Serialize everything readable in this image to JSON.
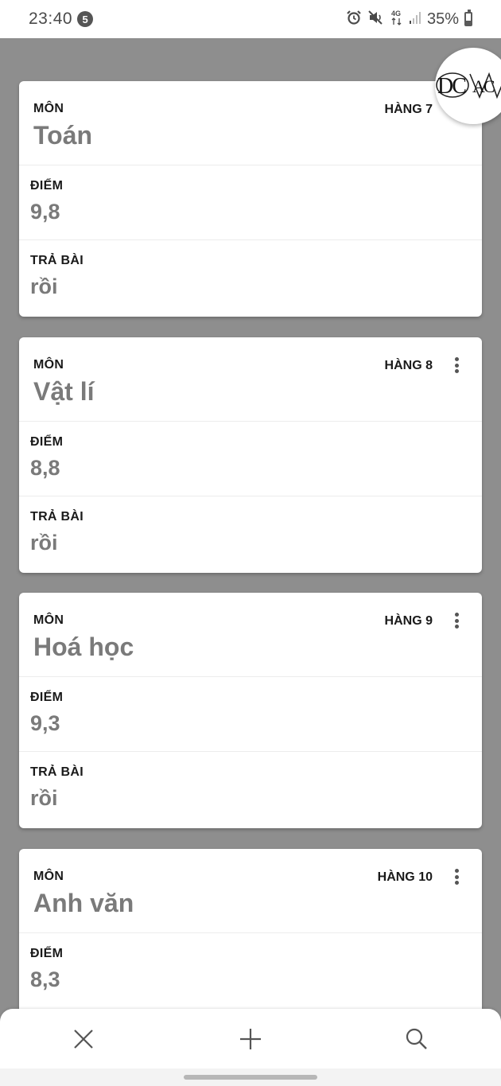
{
  "status_bar": {
    "time": "23:40",
    "notification_count": "5",
    "network": "4G",
    "battery": "35%",
    "battery_level": 0.35,
    "icons": [
      "alarm-icon",
      "mute-icon",
      "network-4g-icon",
      "signal-icon",
      "battery-icon"
    ]
  },
  "logo": {
    "text": "DC WAC"
  },
  "cards": [
    {
      "subject_label": "MÔN",
      "subject": "Toán",
      "row": "HÀNG 7",
      "score_label": "ĐIỂM",
      "score": "9,8",
      "returned_label": "TRẢ BÀI",
      "returned": "rồi"
    },
    {
      "subject_label": "MÔN",
      "subject": "Vật lí",
      "row": "HÀNG 8",
      "score_label": "ĐIỂM",
      "score": "8,8",
      "returned_label": "TRẢ BÀI",
      "returned": "rồi"
    },
    {
      "subject_label": "MÔN",
      "subject": "Hoá học",
      "row": "HÀNG 9",
      "score_label": "ĐIỂM",
      "score": "9,3",
      "returned_label": "TRẢ BÀI",
      "returned": "rồi"
    },
    {
      "subject_label": "MÔN",
      "subject": "Anh văn",
      "row": "HÀNG 10",
      "score_label": "ĐIỂM",
      "score": "8,3"
    }
  ],
  "bottom_bar": {
    "buttons": [
      "close-icon",
      "add-icon",
      "search-icon"
    ]
  },
  "colors": {
    "background": "#8e8e8e",
    "card": "#ffffff",
    "value_text": "#7a7a7a",
    "label_text": "#1a1a1a"
  }
}
